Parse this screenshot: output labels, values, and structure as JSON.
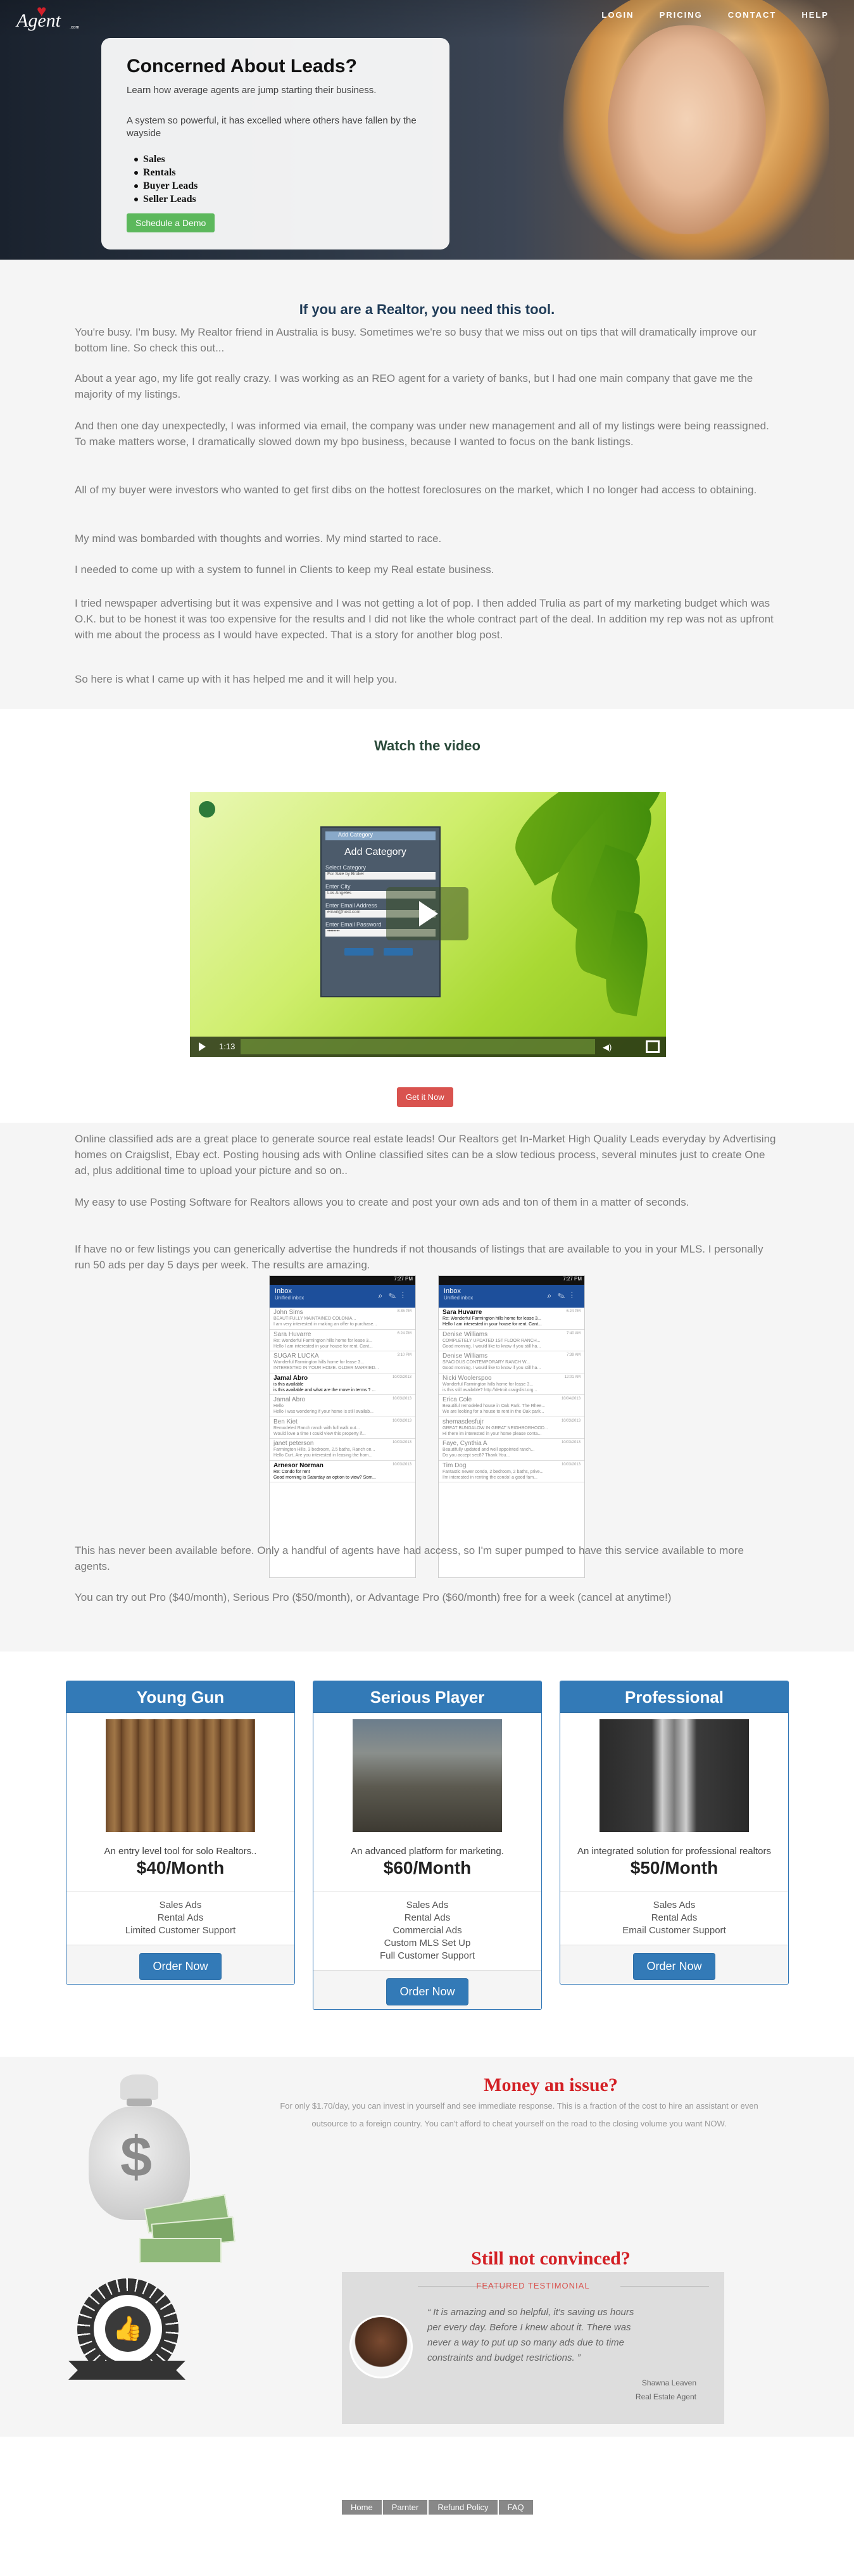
{
  "logo": {
    "text": "Agent",
    "small": ".com"
  },
  "nav": [
    "LOGIN",
    "PRICING",
    "CONTACT",
    "HELP"
  ],
  "hero": {
    "title": "Concerned About Leads?",
    "lead": "Learn how average agents are jump starting their business.",
    "pitch": "A system so powerful, it has excelled where others have fallen by the wayside",
    "bullets": [
      "Sales",
      "Rentals",
      "Buyer Leads",
      "Seller Leads"
    ],
    "button": "Schedule a Demo"
  },
  "intro": {
    "heading": "If you are a Realtor, you need this tool.",
    "paragraphs": [
      "You're busy. I'm busy. My Realtor friend in Australia is busy. Sometimes we're so busy that we miss out on tips that will dramatically improve our bottom line. So check this out...",
      "About a year ago, my life got really crazy. I was working as an REO agent for a variety of banks, but I had one main company that gave me the majority of my listings.",
      "And then one day unexpectedly, I was informed via email, the company was under new management and all of my listings were being reassigned. To make matters worse, I dramatically slowed down my bpo business, because I wanted to focus on the bank listings.",
      "All of my buyer were investors who wanted to get first dibs on the hottest foreclosures on the market, which I no longer had access to obtaining.",
      "My mind was bombarded with thoughts and worries. My mind started to race.",
      "I needed to come up with a system to funnel in Clients to keep my Real estate business.",
      "I tried newspaper advertising but it was expensive and I was not getting a lot of pop. I then added Trulia as part of my marketing budget which was O.K. but to be honest it was too expensive for the results and I did not like the whole contract part of the deal. In addition my rep was not as upfront with me about the process as I would have expected. That is a story for another blog post.",
      "So here is what I came up with it has helped me and it will help you."
    ]
  },
  "video": {
    "heading": "Watch the video",
    "dialog": {
      "window_title": "Add Category",
      "title": "Add Category",
      "labels": [
        "Select Category",
        "Enter City",
        "Enter Email Address",
        "Enter Email Password"
      ],
      "values": [
        "For Sale by Broker",
        "Los Angeles",
        "email@host.com",
        "••••••••"
      ]
    },
    "time": "1:13",
    "cta": "Get it Now"
  },
  "after_video": {
    "paragraphs": [
      "Online classified ads are a great place to generate source real estate leads! Our Realtors get In-Market High Quality Leads everyday by Advertising homes on Craigslist, Ebay ect. Posting housing ads with Online classified sites can be a slow tedious process, several minutes just to create One ad, plus additional time to upload your picture and so on..",
      "My easy to use Posting Software for Realtors allows you to create and post your own ads and ton of them in a matter of seconds.",
      "If have no or few listings you can generically advertise the hundreds if not thousands of listings that are available to you in your MLS. I personally run 50 ads per day 5 days per week. The results are amazing.",
      "This has never been available before. Only a handful of agents have had access, so I'm super pumped to have this service available to more agents.",
      "You can try out Pro ($40/month), Serious Pro ($50/month), or Advantage Pro ($60/month) free for a week (cancel at anytime!)"
    ],
    "phones": [
      {
        "status": "7:27 PM",
        "title": "Inbox",
        "subtitle": "Unified inbox",
        "messages": [
          {
            "name": "John Sims",
            "subject": "BEAUTIFULLY MAINTAINED COLONIA...",
            "preview": "I am very interested in making an offer to purchase...",
            "date": "8:35 PM",
            "bold": false
          },
          {
            "name": "Sara Huvarre",
            "subject": "Re: Wonderful Farmington hills home for lease 3...",
            "preview": "Hello I am interested in your house for rent. Cant...",
            "date": "6:24 PM",
            "bold": false
          },
          {
            "name": "SUGAR LUCKA",
            "subject": "Wonderful Farmington hills home for lease 3...",
            "preview": "INTERESTED IN YOUR HOME. OLDER MARRIED...",
            "date": "3:10 PM",
            "bold": false
          },
          {
            "name": "Jamal Abro",
            "subject": "is this available",
            "preview": "is this available and what are the move in terms ? ...",
            "date": "10/03/2013",
            "bold": true
          },
          {
            "name": "Jamal Abro",
            "subject": "Hello",
            "preview": "Hello I was wondering if your home is still availab...",
            "date": "10/03/2013",
            "bold": false
          },
          {
            "name": "Ben Kiet",
            "subject": "Remodeled Ranch ranch with full walk out...",
            "preview": "Would love a time I could view this property if...",
            "date": "10/03/2013",
            "bold": false
          },
          {
            "name": "janet peterson",
            "subject": "Farmington Hills, 3 bedroom, 2.5 baths, Ranch on...",
            "preview": "Hello Curt, Are you interested in leasing the hom...",
            "date": "10/03/2013",
            "bold": false
          },
          {
            "name": "Arnesor Norman",
            "subject": "Re: Condo for rent",
            "preview": "Good morning is Saturday an option to view? Som...",
            "date": "10/03/2013",
            "bold": true
          }
        ]
      },
      {
        "status": "7:27 PM",
        "title": "Inbox",
        "subtitle": "Unified inbox",
        "messages": [
          {
            "name": "Sara Huvarre",
            "subject": "Re: Wonderful Farmington hills home for lease 3...",
            "preview": "Hello I am interested in your house for rent. Cant...",
            "date": "6:24 PM",
            "bold": true
          },
          {
            "name": "Denise Williams",
            "subject": "COMPLETELY UPDATED 1ST FLOOR RANCH...",
            "preview": "Good morning. I would like to know if you still ha...",
            "date": "7:40 AM",
            "bold": false
          },
          {
            "name": "Denise Williams",
            "subject": "SPACIOUS CONTEMPORARY RANCH W...",
            "preview": "Good morning. I would like to know if you still ha...",
            "date": "7:39 AM",
            "bold": false
          },
          {
            "name": "Nicki Woolerspoo",
            "subject": "Wonderful Farmington hills home for lease 3...",
            "preview": "is this still available? http://detroit.craigslist.org...",
            "date": "12:01 AM",
            "bold": false
          },
          {
            "name": "Erica Cole",
            "subject": "Beautiful remodeled house in Oak Park. The Rhee...",
            "preview": "We are looking for a house to rent in the Oak park...",
            "date": "10/04/2013",
            "bold": false
          },
          {
            "name": "shemasdesfujr",
            "subject": "GREAT BUNGALOW IN GREAT NEIGHBORHOOD...",
            "preview": "Hi there im interested in your home please conta...",
            "date": "10/03/2013",
            "bold": false
          },
          {
            "name": "Faye, Cynthia A",
            "subject": "Beautifully updated and well appointed ranch...",
            "preview": "Do you accept sec8? Thank You...",
            "date": "10/03/2013",
            "bold": false
          },
          {
            "name": "Tim Dog",
            "subject": "Fantastic newer condo, 2 bedroom, 2 baths, prive...",
            "preview": "I'm interested in renting the condo! a good fam...",
            "date": "10/03/2013",
            "bold": false
          }
        ]
      }
    ]
  },
  "pricing": [
    {
      "name": "Young Gun",
      "tagline": "An entry level tool for solo Realtors..",
      "price": "$40/Month",
      "features": [
        "Sales Ads",
        "Rental Ads",
        "Limited Customer Support"
      ],
      "button": "Order Now",
      "image": "wood-texture"
    },
    {
      "name": "Serious Player",
      "tagline": "An advanced platform for marketing.",
      "price": "$60/Month",
      "features": [
        "Sales Ads",
        "Rental Ads",
        "Commercial Ads",
        "Custom MLS Set Up",
        "Full Customer Support"
      ],
      "button": "Order Now",
      "image": "city-skyline"
    },
    {
      "name": "Professional",
      "tagline": "An integrated solution for professional realtors",
      "price": "$50/Month",
      "features": [
        "Sales Ads",
        "Rental Ads",
        "Email Customer Support"
      ],
      "button": "Order Now",
      "image": "suit-and-tie"
    }
  ],
  "issue": {
    "heading": "Money an issue?",
    "text_line1": "For only $1.70/day, you can invest in yourself and see immediate response. This is a fraction of the cost to hire an assistant or even",
    "text_line2": "outsource to a foreign country. You can't afford to cheat yourself on the road to the closing volume you want NOW.",
    "heading2": "Still not convinced?",
    "testimonial_label": "FEATURED TESTIMONIAL",
    "quote": "It is amazing and so helpful, it's saving us hours per every day. Before I knew about it. There was never a way to put up so many ads due to time constraints and budget restrictions.",
    "author": "Shawna Leaven",
    "role": "Real Estate Agent"
  },
  "footer": {
    "links": [
      "Home",
      "Parnter",
      "Refund Policy",
      "FAQ"
    ]
  },
  "colors": {
    "primary": "#337ab7",
    "green": "#5cb85c",
    "red": "#d9534f",
    "heading": "#d32025"
  }
}
